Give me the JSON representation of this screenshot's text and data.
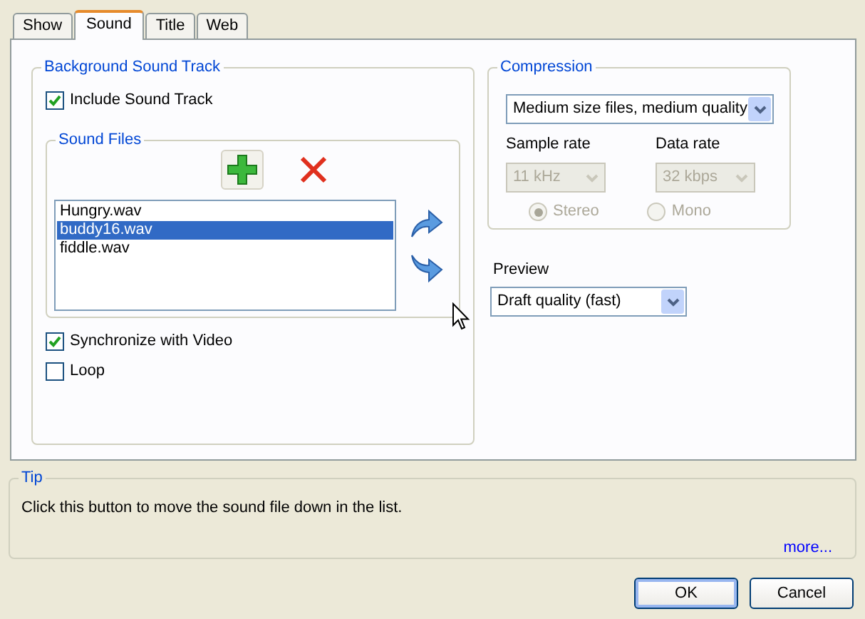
{
  "tabs": [
    {
      "label": "Show",
      "selected": false
    },
    {
      "label": "Sound",
      "selected": true
    },
    {
      "label": "Title",
      "selected": false
    },
    {
      "label": "Web",
      "selected": false
    }
  ],
  "background_sound_track": {
    "title": "Background Sound Track",
    "include": {
      "label": "Include Sound Track",
      "checked": true
    },
    "sound_files": {
      "title": "Sound Files",
      "files": [
        {
          "name": "Hungry.wav",
          "selected": false
        },
        {
          "name": "buddy16.wav",
          "selected": true
        },
        {
          "name": "fiddle.wav",
          "selected": false
        }
      ]
    },
    "synchronize": {
      "label": "Synchronize with Video",
      "checked": true
    },
    "loop": {
      "label": "Loop",
      "checked": false
    }
  },
  "compression": {
    "title": "Compression",
    "preset": "Medium size files, medium quality",
    "sample_rate": {
      "label": "Sample rate",
      "value": "11 kHz",
      "disabled": true
    },
    "data_rate": {
      "label": "Data rate",
      "value": "32 kbps",
      "disabled": true
    },
    "channels": [
      {
        "label": "Stereo",
        "selected": true,
        "disabled": true
      },
      {
        "label": "Mono",
        "selected": false,
        "disabled": true
      }
    ]
  },
  "preview": {
    "label": "Preview",
    "value": "Draft quality (fast)"
  },
  "tip": {
    "title": "Tip",
    "text": "Click this button to move the sound file down in the list.",
    "link": "more..."
  },
  "buttons": [
    {
      "label": "OK",
      "default": true
    },
    {
      "label": "Cancel",
      "default": false
    }
  ]
}
